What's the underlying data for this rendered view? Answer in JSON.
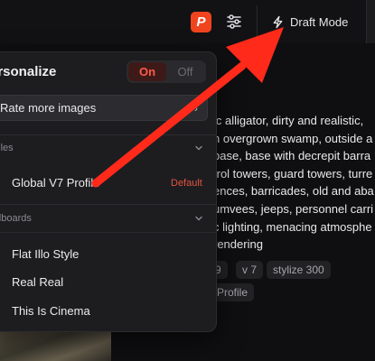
{
  "topbar": {
    "badge_letter": "P",
    "draft_mode_label": "Draft Mode",
    "icons": {
      "sliders": "sliders-icon",
      "bolt": "lightning-bolt-icon"
    },
    "colors": {
      "badge": "#f0441f"
    }
  },
  "panel": {
    "title": "ersonalize",
    "toggle_on": "On",
    "toggle_off": "Off",
    "rate_button": "Rate more images",
    "profiles_label": "ofiles",
    "profile_name": "Global V7 Profile",
    "profile_default": "Default",
    "moodboards_label": "odboards",
    "moodboards": [
      "Flat Illo Style",
      "Real Real",
      "This Is Cinema"
    ]
  },
  "prompt": {
    "lines": [
      "ic alligator, dirty and realistic,",
      "n overgrown swamp, outside a",
      "base, base with decrepit barra",
      "trol towers, guard towers, turre",
      "ences, barricades, old and aba",
      "umvees, jeeps, personnel carri",
      "c lighting, menacing atmosphe",
      " rendering"
    ]
  },
  "chips": {
    "row1": [
      "9",
      "v 7",
      "stylize 300"
    ],
    "row2": [
      "Profile"
    ]
  },
  "annotation": {
    "arrow_color": "#ff2a1a"
  }
}
